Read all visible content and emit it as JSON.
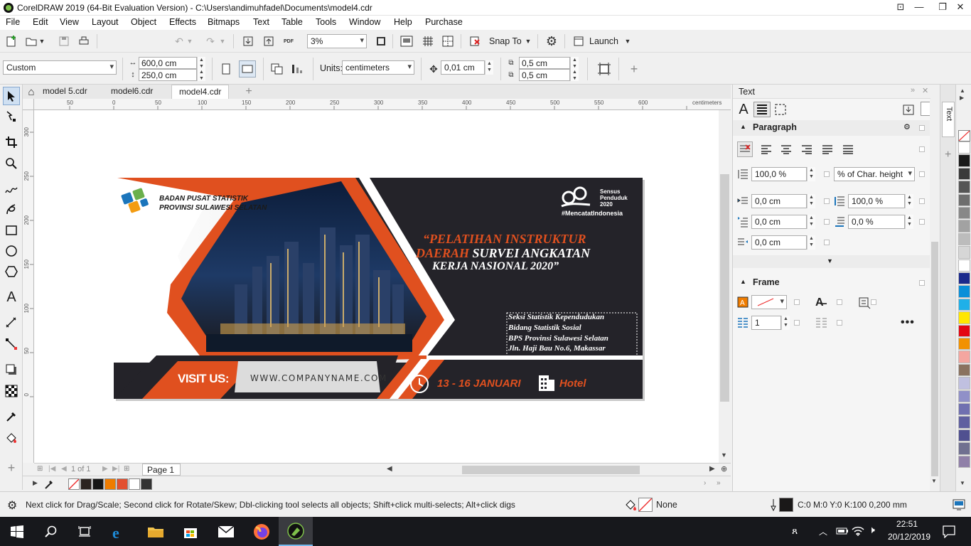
{
  "window": {
    "title": "CorelDRAW 2019 (64-Bit Evaluation Version) - C:\\Users\\andimuhfadel\\Documents\\model4.cdr"
  },
  "menu": [
    "File",
    "Edit",
    "View",
    "Layout",
    "Object",
    "Effects",
    "Bitmaps",
    "Text",
    "Table",
    "Tools",
    "Window",
    "Help",
    "Purchase"
  ],
  "toolbar": {
    "zoom": "3%",
    "snap_label": "Snap To",
    "launch_label": "Launch",
    "pdf_label": "PDF"
  },
  "property_bar": {
    "page_preset": "Custom",
    "width": "600,0 cm",
    "height": "250,0 cm",
    "units_label": "Units:",
    "units_value": "centimeters",
    "nudge": "0,01 cm",
    "dup_x": "0,5 cm",
    "dup_y": "0,5 cm"
  },
  "doc_tabs": [
    "model 5.cdr",
    "model6.cdr",
    "model4.cdr"
  ],
  "ruler": {
    "unit": "centimeters",
    "h_ticks": [
      "50",
      "0",
      "50",
      "100",
      "150",
      "200",
      "250",
      "300",
      "350",
      "400",
      "450",
      "500",
      "550",
      "600"
    ],
    "v_ticks": [
      "300",
      "250",
      "200",
      "150",
      "100",
      "50",
      "0"
    ]
  },
  "design": {
    "org_line1": "BADAN PUSAT STATISTIK",
    "org_line2": "PROVINSI SULAWESI SELATAN",
    "census_line1": "Sensus",
    "census_line2": "Penduduk",
    "census_year": "2020",
    "hashtag": "#MencatatIndonesia",
    "headline_line1": "“PELATIHAN INSTRUKTUR",
    "headline_line2a": "DAERAH",
    "headline_line2b": " SURVEI ANGKATAN",
    "headline_line3": "KERJA NASIONAL 2020”",
    "address": [
      "Seksi Statistik Kependudukan",
      "Bidang Statistik Sosial",
      "BPS Provinsi Sulawesi Selatan",
      "Jln. Haji Bau No.6, Makassar"
    ],
    "visit_label": "VISIT US:",
    "website": "WWW.COMPANYNAME.COM",
    "date": "13 - 16 JANUARI",
    "venue": "Hotel"
  },
  "page_nav": {
    "page_count_text": "1 of 1",
    "page_tab": "Page 1"
  },
  "docker": {
    "tab_title": "Text",
    "paragraph_title": "Paragraph",
    "line_spacing": "100,0 %",
    "spacing_unit": "% of Char. height",
    "left_indent": "0,0 cm",
    "char_spacing": "100,0 %",
    "first_line_indent": "0,0 cm",
    "word_spacing": "0,0 %",
    "right_indent": "0,0 cm",
    "frame_title": "Frame",
    "columns": "1"
  },
  "status": {
    "hint": "Next click for Drag/Scale; Second click for Rotate/Skew; Dbl-clicking tool selects all objects; Shift+click multi-selects; Alt+click digs",
    "fill_label": "None",
    "outline_label": "C:0 M:0 Y:0 K:100  0,200 mm"
  },
  "taskbar": {
    "time": "22:51",
    "date": "20/12/2019"
  },
  "colors": {
    "accent_orange": "#e0501f",
    "design_dark": "#242329",
    "taskbar": "#17181c"
  },
  "palette_colors": [
    "#ffffff",
    "#1a1a1a",
    "#3a3a3a",
    "#555555",
    "#6e6e6e",
    "#888888",
    "#a2a2a2",
    "#bcbcbc",
    "#d6d6d6",
    "#ffffff",
    "#1c2a8c",
    "#0a8fd8",
    "#1fb0e8",
    "#ffe600",
    "#e30613",
    "#f29100",
    "#f4a6a0",
    "#8a7260",
    "#c0c0e0",
    "#9090c8",
    "#7070b0",
    "#6060a0",
    "#505090",
    "#707090",
    "#9080a8"
  ],
  "bottom_swatches": [
    "#2b2320",
    "#151515",
    "#ef7c00",
    "#e25030",
    "#ffffff",
    "#333333"
  ]
}
